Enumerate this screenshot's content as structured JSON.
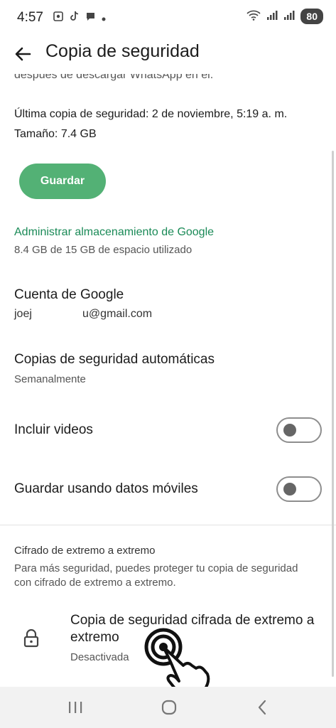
{
  "status_bar": {
    "time": "4:57",
    "battery": "80"
  },
  "header": {
    "title": "Copia de seguridad"
  },
  "partial_text": "después de descargar WhatsApp en el.",
  "backup_info": {
    "last_backup": "Última copia de seguridad: 2 de noviembre, 5:19 a. m.",
    "size": "Tamaño: 7.4 GB",
    "save_label": "Guardar"
  },
  "storage": {
    "manage_label": "Administrar almacenamiento de Google",
    "used": "8.4 GB de 15 GB de espacio utilizado"
  },
  "account": {
    "title": "Cuenta de Google",
    "email": "joej                u@gmail.com"
  },
  "auto_backup": {
    "title": "Copias de seguridad automáticas",
    "value": "Semanalmente"
  },
  "toggles": {
    "videos_label": "Incluir videos",
    "videos_on": false,
    "mobile_label": "Guardar usando datos móviles",
    "mobile_on": false
  },
  "e2e": {
    "section_title": "Cifrado de extremo a extremo",
    "description": "Para más seguridad, puedes proteger tu copia de seguridad con cifrado de extremo a extremo.",
    "item_title": "Copia de seguridad cifrada de extremo a extremo",
    "item_status": "Desactivada"
  },
  "colors": {
    "accent_green": "#53b175",
    "link_green": "#1a8a57"
  }
}
